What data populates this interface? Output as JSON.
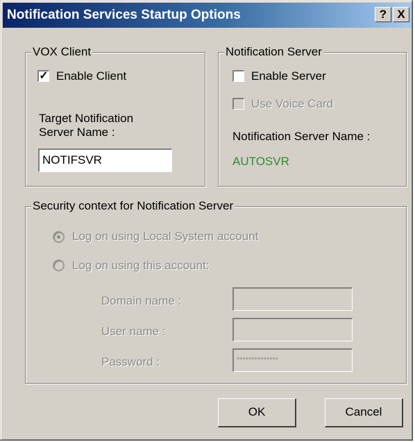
{
  "window": {
    "title": "Notification Services Startup Options",
    "help_label": "?",
    "close_label": "X"
  },
  "vox_client": {
    "legend": "VOX Client",
    "enable_client": {
      "label": "Enable Client",
      "checked": true
    },
    "target_label_line1": "Target Notification",
    "target_label_line2": "Server Name :",
    "target_value": "NOTIFSVR"
  },
  "notification_server": {
    "legend": "Notification Server",
    "enable_server": {
      "label": "Enable Server",
      "checked": false
    },
    "use_voice_card": {
      "label": "Use Voice Card",
      "checked": false,
      "enabled": false
    },
    "server_name_label": "Notification Server Name :",
    "server_name_value": "AUTOSVR",
    "server_name_color": "#2e8b2e"
  },
  "security": {
    "legend": "Security context for Notification Server",
    "local_system_label": "Log on using Local System account",
    "this_account_label": "Log on using this account:",
    "selected": "local_system",
    "domain_label": "Domain name :",
    "domain_value": "",
    "user_label": "User name :",
    "user_value": "",
    "password_label": "Password :",
    "password_value": "**************"
  },
  "buttons": {
    "ok": "OK",
    "cancel": "Cancel"
  }
}
